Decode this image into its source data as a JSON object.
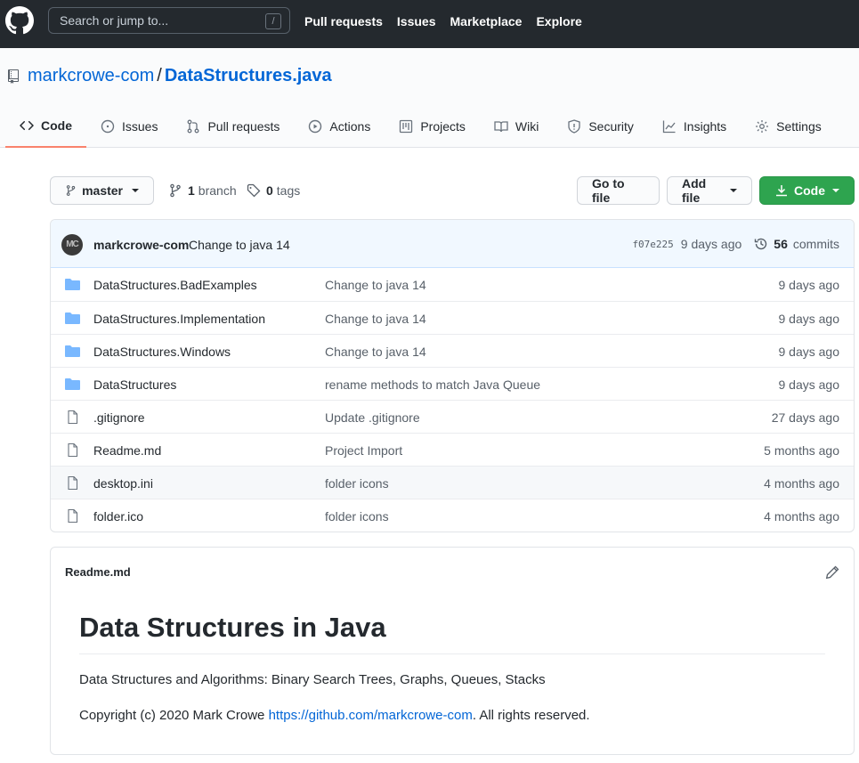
{
  "header": {
    "search_placeholder": "Search or jump to...",
    "search_shortcut": "/",
    "nav": [
      "Pull requests",
      "Issues",
      "Marketplace",
      "Explore"
    ]
  },
  "repo": {
    "owner": "markcrowe-com",
    "separator": "/",
    "name": "DataStructures.java",
    "tabs": [
      {
        "label": "Code",
        "icon": "code-icon"
      },
      {
        "label": "Issues",
        "icon": "issue-icon"
      },
      {
        "label": "Pull requests",
        "icon": "pull-request-icon"
      },
      {
        "label": "Actions",
        "icon": "play-icon"
      },
      {
        "label": "Projects",
        "icon": "project-icon"
      },
      {
        "label": "Wiki",
        "icon": "book-icon"
      },
      {
        "label": "Security",
        "icon": "shield-icon"
      },
      {
        "label": "Insights",
        "icon": "graph-icon"
      },
      {
        "label": "Settings",
        "icon": "gear-icon"
      }
    ]
  },
  "toolbar": {
    "branch": "master",
    "branch_count": "1",
    "branch_label": "branch",
    "tag_count": "0",
    "tag_label": "tags",
    "go_to_file": "Go to file",
    "add_file": "Add file",
    "code": "Code"
  },
  "commit": {
    "avatar": "MC",
    "author": "markcrowe-com",
    "message": "Change to java 14",
    "sha": "f07e225",
    "age": "9 days ago",
    "count": "56",
    "count_label": "commits"
  },
  "files": [
    {
      "type": "dir",
      "name": "DataStructures.BadExamples",
      "message": "Change to java 14",
      "age": "9 days ago"
    },
    {
      "type": "dir",
      "name": "DataStructures.Implementation",
      "message": "Change to java 14",
      "age": "9 days ago"
    },
    {
      "type": "dir",
      "name": "DataStructures.Windows",
      "message": "Change to java 14",
      "age": "9 days ago"
    },
    {
      "type": "dir",
      "name": "DataStructures",
      "message": "rename methods to match Java Queue",
      "age": "9 days ago"
    },
    {
      "type": "file",
      "name": ".gitignore",
      "message": "Update .gitignore",
      "age": "27 days ago"
    },
    {
      "type": "file",
      "name": "Readme.md",
      "message": "Project Import",
      "age": "5 months ago"
    },
    {
      "type": "file",
      "name": "desktop.ini",
      "message": "folder icons",
      "age": "4 months ago"
    },
    {
      "type": "file",
      "name": "folder.ico",
      "message": "folder icons",
      "age": "4 months ago"
    }
  ],
  "readme": {
    "filename": "Readme.md",
    "heading": "Data Structures in Java",
    "description": "Data Structures and Algorithms: Binary Search Trees, Graphs, Queues, Stacks",
    "copyright_prefix": "Copyright (c) 2020 Mark Crowe ",
    "copyright_link": "https://github.com/markcrowe-com",
    "copyright_suffix": ". All rights reserved."
  },
  "colors": {
    "header_bg": "#24292e",
    "link": "#0366d6",
    "active_tab_underline": "#f9826c",
    "code_button": "#2ea44f",
    "folder": "#79b8ff",
    "commit_bar": "#f1f8ff"
  }
}
